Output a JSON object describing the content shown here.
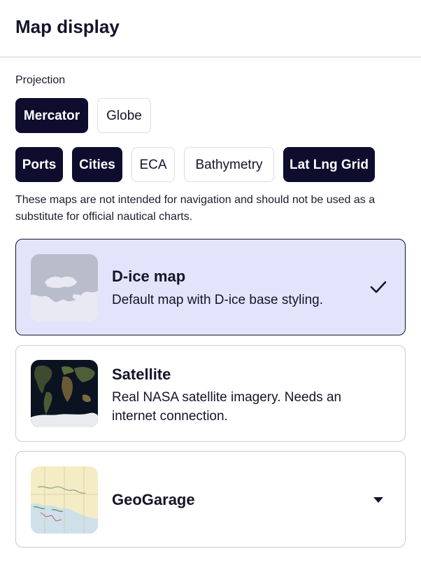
{
  "header": {
    "title": "Map display"
  },
  "projection": {
    "label": "Projection",
    "options": [
      {
        "label": "Mercator",
        "selected": true
      },
      {
        "label": "Globe",
        "selected": false
      }
    ]
  },
  "layers": [
    {
      "label": "Ports",
      "selected": true
    },
    {
      "label": "Cities",
      "selected": true
    },
    {
      "label": "ECA",
      "selected": false
    },
    {
      "label": "Bathymetry",
      "selected": false
    },
    {
      "label": "Lat Lng Grid",
      "selected": true
    }
  ],
  "disclaimer": "These maps are not intended for navigation and should not be used as a substitute for official nautical charts.",
  "maps": [
    {
      "title": "D-ice map",
      "description": "Default map with D-ice base styling.",
      "selected": true,
      "icon": "check-icon"
    },
    {
      "title": "Satellite",
      "description": "Real NASA satellite imagery. Needs an internet connection.",
      "selected": false
    },
    {
      "title": "GeoGarage",
      "description": "",
      "selected": false,
      "icon": "chevron-down-icon"
    }
  ]
}
